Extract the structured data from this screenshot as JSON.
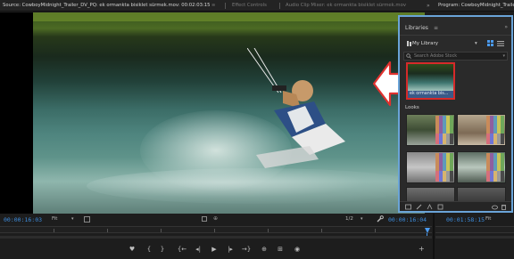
{
  "tabs": {
    "source": "Source: CowboyMidnight_Trailer_DV_PQ: ek ormankta bisiklet sürmek.mov: 00:02:03:15",
    "source_menu": "≡",
    "effect_controls": "Effect Controls",
    "audio_clip_mixer": "Audio Clip Mixer: ek ormankta bisiklet sürmek.mov",
    "overflow": "»",
    "program": "Program: CowboyMidnight_Trailer_DV_PQ"
  },
  "libraries": {
    "title": "Libraries",
    "menu": "≡",
    "expand": "»",
    "library_name": "My Library",
    "library_chevron": "▾",
    "search_placeholder": "Search Adobe Stock",
    "search_dropdown": "▾",
    "asset_caption": "ek ormankta bis...",
    "looks_label": "Looks"
  },
  "source_monitor": {
    "timecode_in": "00:00:16:03",
    "fit_label": "Fit",
    "fit_chevron": "▾",
    "resolution": "1/2",
    "resolution_chevron": "▾",
    "timecode_duration": "00:00:16:04",
    "insert_icon": "⊕"
  },
  "program_monitor": {
    "timecode": "00:01:58:15",
    "fit_label": "Fit"
  },
  "transport": {
    "marker": "♥",
    "mark_in": "{",
    "mark_out": "}",
    "go_to_in": "{←",
    "step_back": "◂|",
    "play": "▶",
    "step_forward": "|▸",
    "go_to_out": "→}",
    "insert": "⊕",
    "overwrite": "⊞",
    "export_frame": "◉",
    "add": "+"
  },
  "colors": {
    "accent_blue": "#3d8ee0",
    "selection_red": "#d62a2a",
    "panel_border": "#6aa4d8",
    "annotation_arrow": "#e0312e"
  }
}
